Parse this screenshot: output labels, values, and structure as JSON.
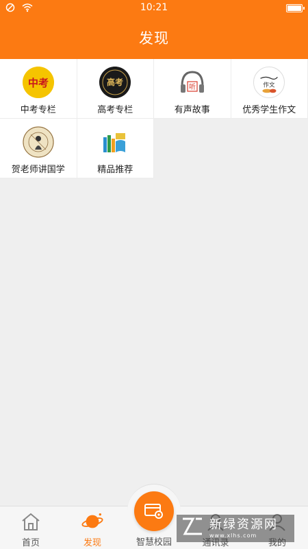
{
  "status_bar": {
    "time": "10:21"
  },
  "header": {
    "title": "发现"
  },
  "tiles": [
    {
      "label": "中考专栏",
      "icon": "zhongkao-logo-icon",
      "badge_text": "中考"
    },
    {
      "label": "高考专栏",
      "icon": "gaokao-logo-icon",
      "badge_text": "高考"
    },
    {
      "label": "有声故事",
      "icon": "headphones-icon",
      "badge_text": "听"
    },
    {
      "label": "优秀学生作文",
      "icon": "essay-logo-icon",
      "badge_text": "作文"
    },
    {
      "label": "贺老师讲国学",
      "icon": "chinese-studies-icon",
      "badge_text": ""
    },
    {
      "label": "精品推荐",
      "icon": "books-icon",
      "badge_text": ""
    }
  ],
  "tab_bar": {
    "tabs": [
      {
        "label": "首页",
        "icon": "home-icon"
      },
      {
        "label": "发现",
        "icon": "planet-icon",
        "active": true
      },
      {
        "label": "智慧校园",
        "icon": "campus-settings-icon"
      },
      {
        "label": "通讯录",
        "icon": "contacts-icon"
      },
      {
        "label": "我的",
        "icon": "profile-icon"
      }
    ]
  },
  "watermark": {
    "title": "新绿资源网",
    "url": "www.xlhs.com"
  },
  "colors": {
    "accent": "#fc7a12",
    "background": "#efefef",
    "tile": "#ffffff"
  }
}
